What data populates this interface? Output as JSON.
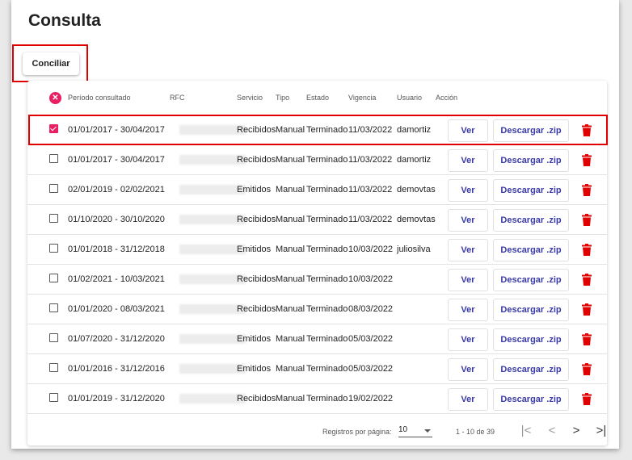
{
  "page": {
    "title": "Consulta"
  },
  "toolbar": {
    "conciliar_label": "Conciliar"
  },
  "table": {
    "clear_selection_icon": "close-circle-icon",
    "columns": [
      "Período consultado",
      "RFC",
      "Servicio",
      "Tipo",
      "Estado",
      "Vigencia",
      "Usuario",
      "Acción"
    ],
    "ver_label": "Ver",
    "zip_label": "Descargar .zip",
    "rows": [
      {
        "periodo": "01/01/2017 - 30/04/2017",
        "servicio": "Recibidos",
        "tipo": "Manual",
        "estado": "Terminado",
        "vigencia": "11/03/2022",
        "usuario": "damortiz",
        "checked": true
      },
      {
        "periodo": "01/01/2017 - 30/04/2017",
        "servicio": "Recibidos",
        "tipo": "Manual",
        "estado": "Terminado",
        "vigencia": "11/03/2022",
        "usuario": "damortiz",
        "checked": false
      },
      {
        "periodo": "02/01/2019 - 02/02/2021",
        "servicio": "Emitidos",
        "tipo": "Manual",
        "estado": "Terminado",
        "vigencia": "11/03/2022",
        "usuario": "demovtas",
        "checked": false
      },
      {
        "periodo": "01/10/2020 - 30/10/2020",
        "servicio": "Recibidos",
        "tipo": "Manual",
        "estado": "Terminado",
        "vigencia": "11/03/2022",
        "usuario": "demovtas",
        "checked": false
      },
      {
        "periodo": "01/01/2018 - 31/12/2018",
        "servicio": "Emitidos",
        "tipo": "Manual",
        "estado": "Terminado",
        "vigencia": "10/03/2022",
        "usuario": "juliosilva",
        "checked": false
      },
      {
        "periodo": "01/02/2021 - 10/03/2021",
        "servicio": "Recibidos",
        "tipo": "Manual",
        "estado": "Terminado",
        "vigencia": "10/03/2022",
        "usuario": "",
        "checked": false
      },
      {
        "periodo": "01/01/2020 - 08/03/2021",
        "servicio": "Recibidos",
        "tipo": "Manual",
        "estado": "Terminado",
        "vigencia": "08/03/2022",
        "usuario": "",
        "checked": false
      },
      {
        "periodo": "01/07/2020 - 31/12/2020",
        "servicio": "Emitidos",
        "tipo": "Manual",
        "estado": "Terminado",
        "vigencia": "05/03/2022",
        "usuario": "",
        "checked": false
      },
      {
        "periodo": "01/01/2016 - 31/12/2016",
        "servicio": "Emitidos",
        "tipo": "Manual",
        "estado": "Terminado",
        "vigencia": "05/03/2022",
        "usuario": "",
        "checked": false
      },
      {
        "periodo": "01/01/2019 - 31/12/2020",
        "servicio": "Recibidos",
        "tipo": "Manual",
        "estado": "Terminado",
        "vigencia": "19/02/2022",
        "usuario": "",
        "checked": false
      }
    ]
  },
  "pagination": {
    "rows_per_page_label": "Registros por página:",
    "rows_per_page_value": "10",
    "range_text": "1 - 10 de 39",
    "first_icon": "|<",
    "prev_icon": "<",
    "next_icon": ">",
    "last_icon": ">|"
  },
  "colors": {
    "accent": "#e91e63",
    "link": "#3a3aa8",
    "delete": "#e10000",
    "highlight": "#e10000"
  }
}
